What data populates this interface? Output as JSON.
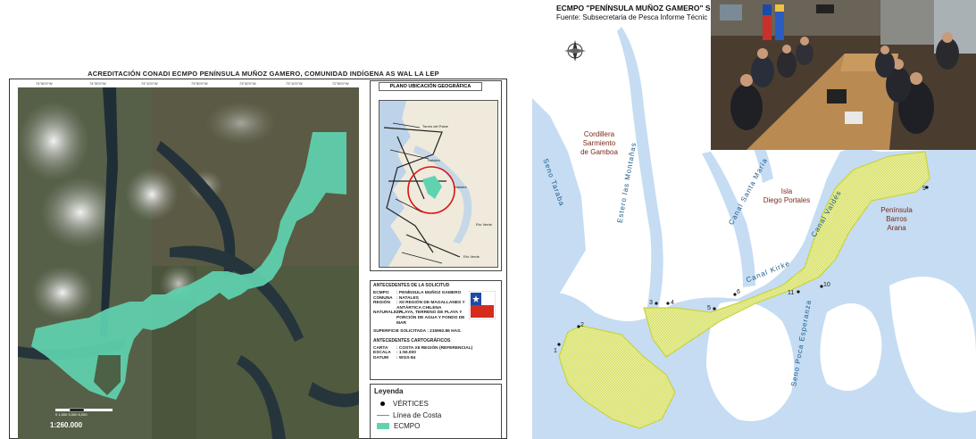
{
  "left_map": {
    "title": "ACREDITACIÓN CONADI ECMPO PENÍNSULA MUÑOZ GAMERO, COMUNIDAD INDÍGENA AS WAL LA LEP",
    "scale": "1:260.000",
    "scale_bar_numbers": "0  1,500 3,000   6,000",
    "location_panel": {
      "title": "PLANO UBICACIÓN GEOGRÁFICA",
      "places": [
        "Torres del Paine",
        "Natales",
        "Natales",
        "Río Verde",
        "Río Verde"
      ]
    },
    "antecedentes_solicitud": {
      "title": "ANTECEDENTES DE LA SOLICITUD",
      "rows": [
        {
          "k": "ECMPO",
          "v": ": PENÍNSULA MUÑOZ GAMERO"
        },
        {
          "k": "COMUNA",
          "v": ": NATALES"
        },
        {
          "k": "REGIÓN",
          "v": ": XII REGIÓN DE MAGALLANES Y ANTÁRTICA CHILENA"
        },
        {
          "k": "NATURALEZA",
          "v": ": PLAYA, TERRENO DE PLAYA Y PORCIÓN DE AGUA Y FONDO DE MAR"
        }
      ],
      "superficie": "SUPERFICIE SOLICITADA : 215992.86 HAS."
    },
    "antecedentes_cartograficos": {
      "title": "ANTECEDENTES CARTOGRÁFICOS",
      "rows": [
        {
          "k": "CARTA",
          "v": ": COSTA XII REGIÓN (REFERENCIAL)"
        },
        {
          "k": "ESCALA",
          "v": ": 1:50.000"
        },
        {
          "k": "DATUM",
          "v": ": WGS-84"
        }
      ]
    },
    "legend": {
      "title": "Leyenda",
      "items": [
        {
          "label": "VÉRTICES",
          "symbol": "dot",
          "color": "#000000"
        },
        {
          "label": "Línea de Costa",
          "symbol": "line",
          "color": "#b07a6a"
        },
        {
          "label": "ECMPO",
          "symbol": "fill",
          "color": "#5fd3b0"
        }
      ]
    }
  },
  "right_map": {
    "title": "ECMPO \"PENÍNSULA MUÑOZ GAMERO\" SO",
    "subtitle": "Fuente: Subsecretaria de Pesca Informe Técnic",
    "place_labels": {
      "cordillera": [
        "Cordillera",
        "Sarmiento",
        "de Gamboa"
      ],
      "isla": [
        "Isla",
        "Diego Portales"
      ],
      "peninsula": [
        "Península",
        "Barros",
        "Arana"
      ]
    },
    "water_labels": {
      "seno_taraba": "Seno Taraba",
      "estero": "Estero las Montañas",
      "canal_santa_maria": "Canal Santa María",
      "canal_valdes": "Canal Valdés",
      "canal_kirke": "Canal Kirke",
      "seno_esperanza": "Seno Poca Esperanza"
    },
    "vertices": [
      "1",
      "2",
      "3",
      "4",
      "5",
      "6",
      "9",
      "10",
      "11"
    ],
    "colors": {
      "water": "#c5dcf3",
      "land": "#ffffff",
      "ecmpo_fill": "#e8eea0",
      "ecmpo_border": "#c8d43a"
    }
  },
  "video_panel": {
    "description_color": "#3a2f26"
  }
}
